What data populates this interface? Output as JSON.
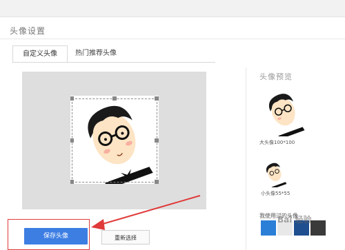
{
  "page": {
    "title": "头像设置"
  },
  "tabs": [
    {
      "label": "自定义头像",
      "active": true
    },
    {
      "label": "热门推荐头像",
      "active": false
    }
  ],
  "preview": {
    "title": "头像预览",
    "large_caption": "大头像100*100",
    "small_caption": "小头像55*55",
    "used_label": "我使用过的头像"
  },
  "buttons": {
    "save": "保存头像",
    "reset": "重新选择"
  },
  "colors": {
    "primary": "#3d7ee3",
    "highlight": "#e03a3a",
    "canvas": "#dedede"
  },
  "watermark": "Bai 经验"
}
